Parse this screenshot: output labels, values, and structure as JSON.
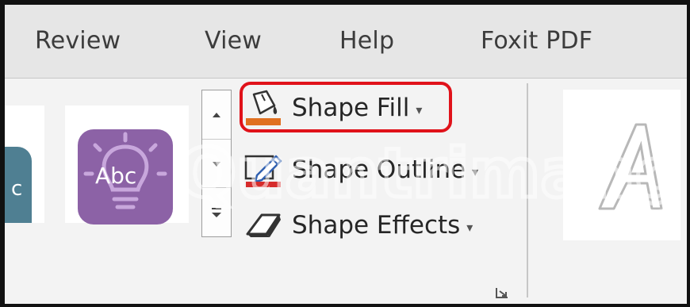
{
  "tabs": [
    {
      "label": "Review"
    },
    {
      "label": "View"
    },
    {
      "label": "Help"
    },
    {
      "label": "Foxit PDF"
    }
  ],
  "shape_styles": {
    "tiles": [
      {
        "label": "c",
        "color": "#4f7f92"
      },
      {
        "label": "Abc",
        "color": "#8c62a6"
      }
    ],
    "scroll_icons": [
      "up-arrow-icon",
      "down-arrow-icon",
      "more-gallery-icon"
    ]
  },
  "commands": {
    "shape_fill": {
      "label": "Shape Fill",
      "accent": "#e07020"
    },
    "shape_outline": {
      "label": "Shape Outline",
      "accent": "#d62b2b"
    },
    "shape_effects": {
      "label": "Shape Effects"
    }
  },
  "highlight_color": "#e0121a",
  "watermark_text": "Quantrimang"
}
